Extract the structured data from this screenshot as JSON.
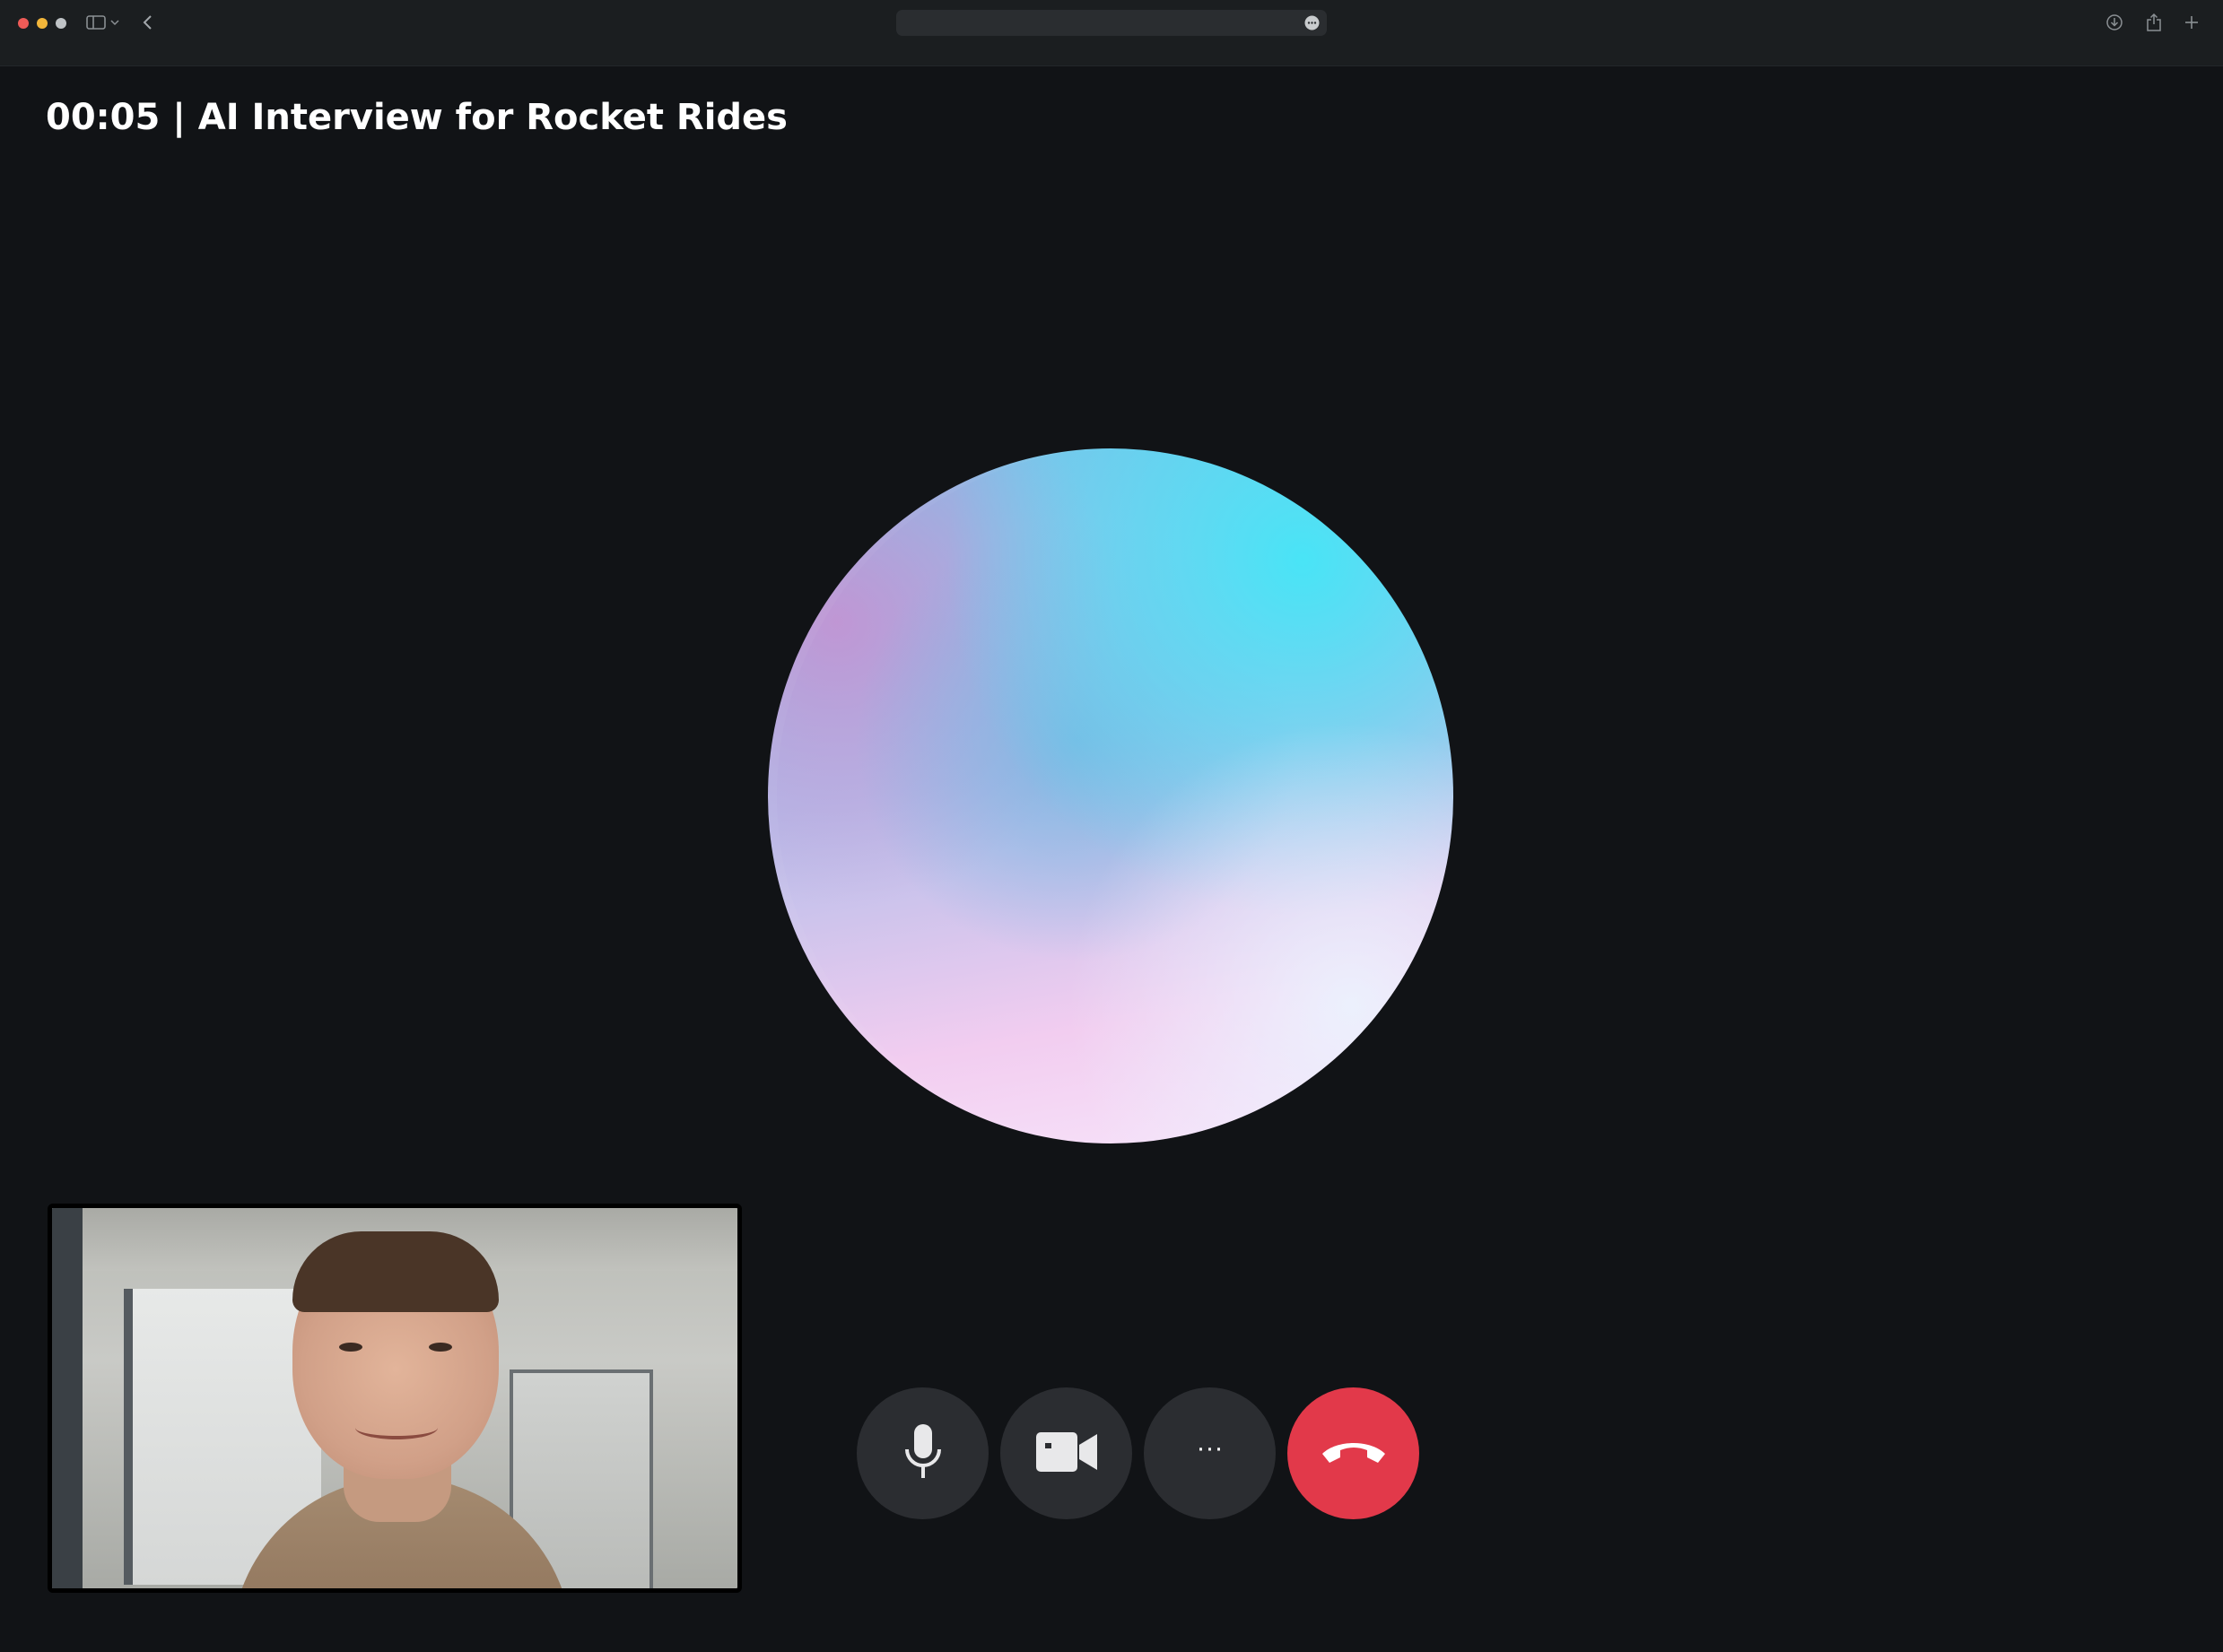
{
  "browser": {
    "address_text": "",
    "icons": {
      "sidebar": "sidebar-toggle-icon",
      "chevron": "chevron-down-icon",
      "back": "back-arrow-icon",
      "reader": "reader-more-icon",
      "download": "download-icon",
      "share": "share-icon",
      "new_tab": "plus-icon"
    }
  },
  "call": {
    "title": "00:05 | AI Interview for Rocket Rides",
    "controls": {
      "mute_icon": "microphone-icon",
      "video_icon": "video-camera-icon",
      "more_label": "···",
      "end_icon": "hang-up-icon"
    }
  },
  "colors": {
    "background": "#111316",
    "control_bg": "#2b2d31",
    "end_call": "#e2394a",
    "orb_cyan": "#49e4f6",
    "orb_pink": "#f2cdf0"
  }
}
